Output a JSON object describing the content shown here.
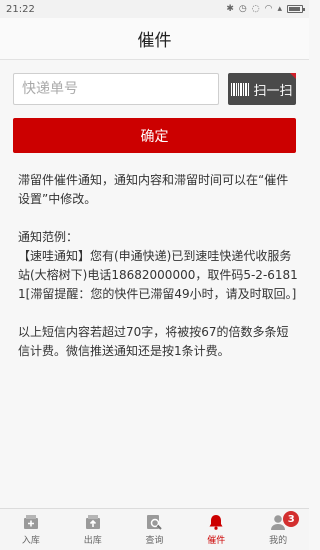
{
  "status_bar": {
    "time": "21:22"
  },
  "nav": {
    "title": "催件"
  },
  "search": {
    "placeholder": "快递单号",
    "value": ""
  },
  "scan_button": {
    "label": "扫一扫",
    "icon": "barcode-icon"
  },
  "confirm_button": {
    "label": "确定"
  },
  "notice": {
    "intro": "滞留件催件通知，通知内容和滞留时间可以在“催件设置”中修改。",
    "example_label": "通知范例：",
    "example_text": "【速哇通知】您有(申通快递)已到速哇快递代收服务站(大榕树下)电话18682000000，取件码5-2-61811[滞留提醒：您的快件已滞留49小时，请及时取回。]",
    "sms_rule": "以上短信内容若超过70字，将被按67的倍数多条短信计费。微信推送通知还是按1条计费。"
  },
  "tabs": [
    {
      "label": "入库",
      "icon": "inbox-plus-icon",
      "active": false
    },
    {
      "label": "出库",
      "icon": "outbox-up-icon",
      "active": false
    },
    {
      "label": "查询",
      "icon": "search-doc-icon",
      "active": false
    },
    {
      "label": "催件",
      "icon": "bell-icon",
      "active": true
    },
    {
      "label": "我的",
      "icon": "user-icon",
      "active": false,
      "badge": "3"
    }
  ],
  "colors": {
    "accent": "#cc0000",
    "scan_bg": "#4a4a4a",
    "badge": "#d32f2f"
  }
}
